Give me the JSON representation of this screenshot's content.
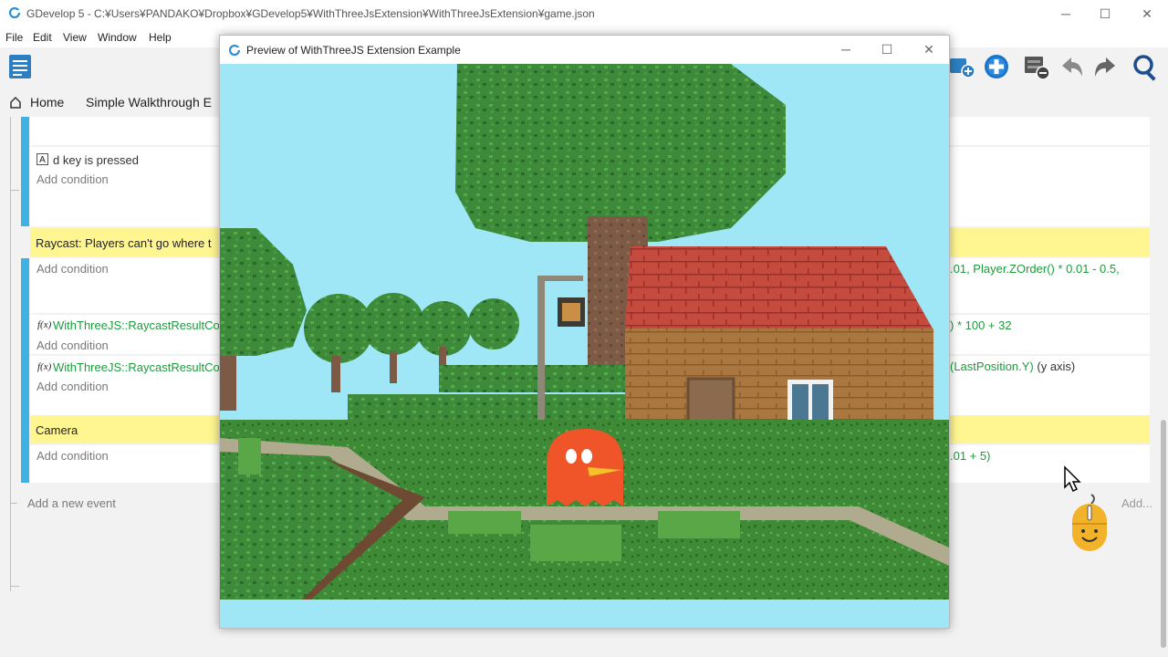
{
  "app": {
    "title": "GDevelop 5 - C:¥Users¥PANDAKO¥Dropbox¥GDevelop5¥WithThreeJsExtension¥WithThreeJsExtension¥game.json"
  },
  "menu": [
    "File",
    "Edit",
    "View",
    "Window",
    "Help"
  ],
  "tabs": {
    "home": "Home",
    "scene": "Simple Walkthrough E"
  },
  "events": {
    "key_condition": "d key is pressed",
    "key_glyph": "A",
    "add_condition": "Add condition",
    "raycast_comment": "Raycast: Players can't go where t",
    "raycast_fn_1": "WithThreeJS::RaycastResultCo",
    "raycast_fn_2": "WithThreeJS::RaycastResultCo",
    "fx_glyph": "f(x)",
    "camera_comment": "Camera",
    "action_1": ".01, Player.ZOrder() * 0.01 - 0.5,",
    "action_2": ") * 100 + 32",
    "action_3_green": "(LastPosition.Y)",
    "action_3_rest": " (y axis)",
    "action_4": ".01 + 5)",
    "add_new_event": "Add a new event",
    "add_right": "Add..."
  },
  "preview": {
    "title": "Preview of WithThreeJS Extension Example"
  },
  "colors": {
    "accent": "#3eb2e2",
    "comment": "#fff691",
    "sky": "#9fe6f7",
    "grass": "#3f8a36",
    "ghost": "#f0552a"
  }
}
